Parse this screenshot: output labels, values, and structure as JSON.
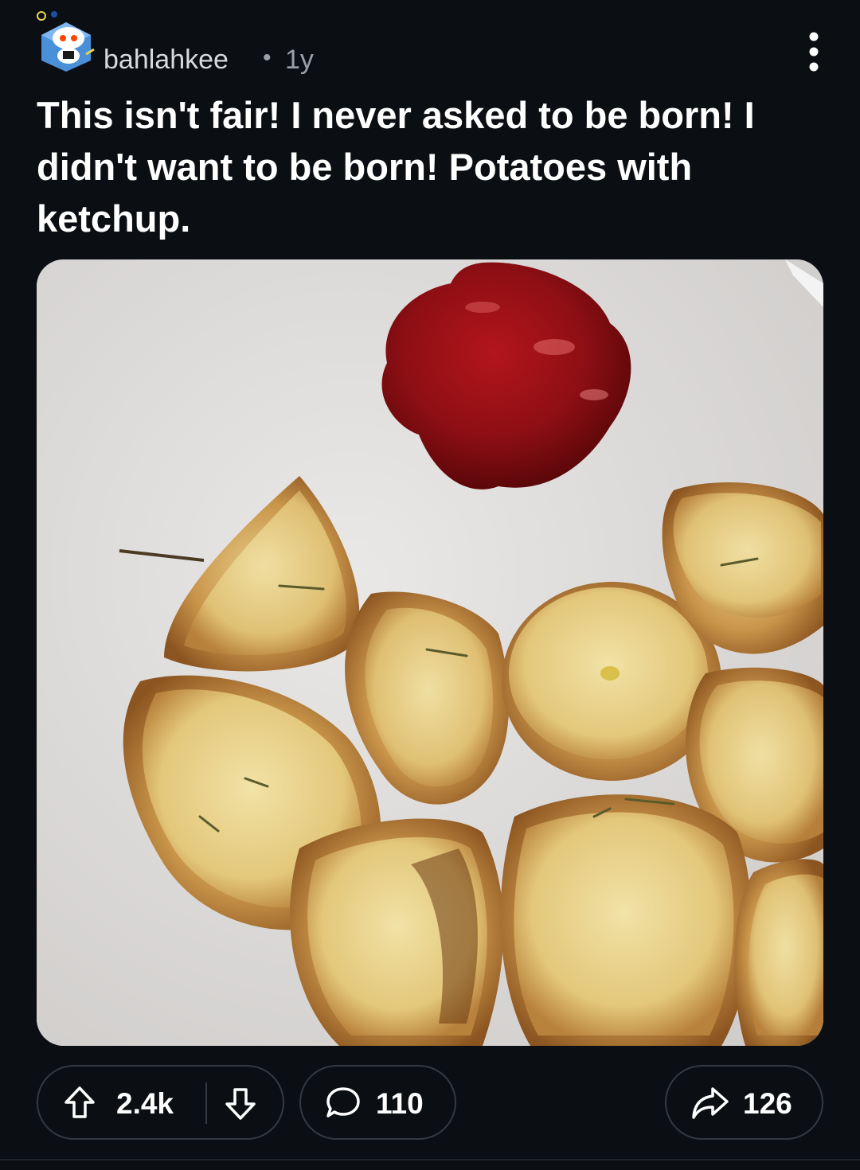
{
  "post": {
    "author": "bahlahkee",
    "separator": "•",
    "age": "1y",
    "title": "This isn't fair! I never asked to be born! I didn't want to be born! Potatoes with ketchup."
  },
  "media": {
    "icon_name": "photo",
    "colors": {
      "plate": "#dcdad9",
      "ketchup": "#8e0f14",
      "potato": "#e6cf86",
      "crust": "#a36a2d"
    }
  },
  "actions": {
    "upvotes": "2.4k",
    "comments": "110",
    "shares": "126"
  },
  "icons": {
    "avatar": "avatar-icon",
    "more": "more-vertical-icon",
    "upvote": "arrow-up-icon",
    "downvote": "arrow-down-icon",
    "comment": "comment-bubble-icon",
    "share": "share-arrow-icon"
  },
  "theme": {
    "background": "#0b0f14",
    "border": "#343a42",
    "text": "#ffffff",
    "muted": "#9aa0a6"
  }
}
